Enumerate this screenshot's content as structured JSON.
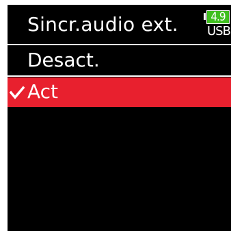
{
  "header": {
    "title": "Sincr.audio ext.",
    "battery_value": "4.9",
    "power_source": "USB"
  },
  "options": [
    {
      "label": "Desact.",
      "selected": false
    },
    {
      "label": "Act",
      "selected": true
    }
  ],
  "colors": {
    "background": "#000000",
    "text": "#ffffff",
    "selection": "#e8202e",
    "battery_fill": "#3fbf1f"
  },
  "icons": {
    "selected_marker": "checkmark-icon",
    "battery": "battery-icon"
  }
}
